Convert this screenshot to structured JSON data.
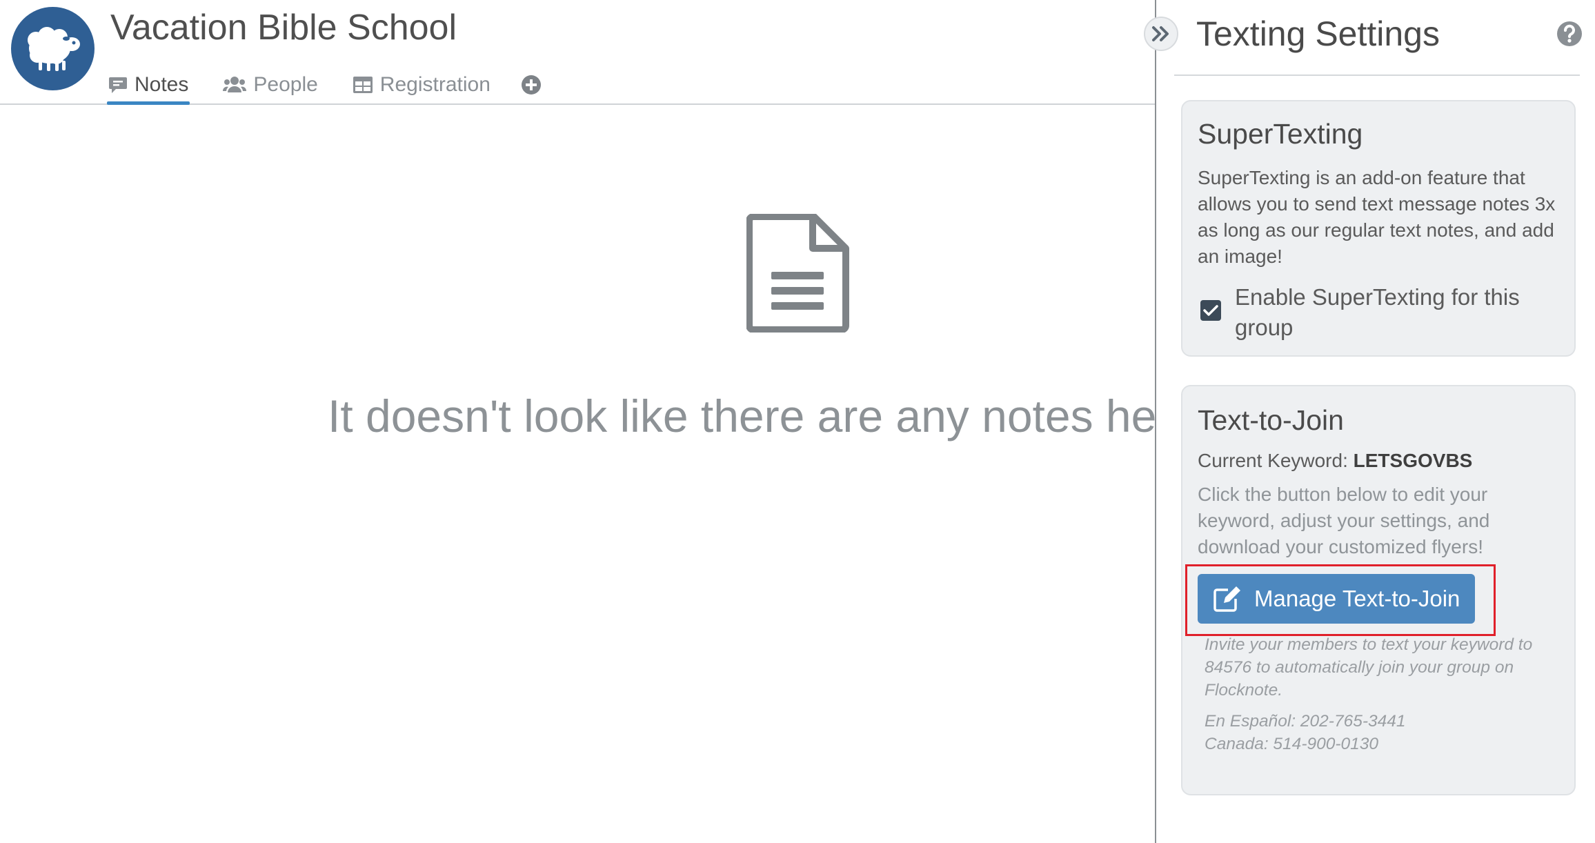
{
  "group": {
    "title": "Vacation Bible School",
    "logo_icon": "sheep-icon"
  },
  "tabs": [
    {
      "label": "Notes",
      "icon": "note-icon",
      "active": true
    },
    {
      "label": "People",
      "icon": "people-icon",
      "active": false
    },
    {
      "label": "Registration",
      "icon": "table-icon",
      "active": false
    }
  ],
  "empty_state": {
    "icon": "document-icon",
    "message": "It doesn't look like there are any notes here yet."
  },
  "panel": {
    "title": "Texting Settings",
    "supertexting": {
      "heading": "SuperTexting",
      "description": "SuperTexting is an add-on feature that allows you to send text message notes 3x as long as our regular text notes, and add an image!",
      "checkbox_label": "Enable SuperTexting for this group",
      "checked": true
    },
    "text_to_join": {
      "heading": "Text-to-Join",
      "keyword_label": "Current Keyword:",
      "keyword": "LETSGOVBS",
      "instructions": "Click the button below to edit your keyword, adjust your settings, and download your customized flyers!",
      "button_label": "Manage Text-to-Join",
      "invite": "Invite your members to text your keyword to 84576 to automatically join your group on Flocknote.",
      "espanol": "En Español: 202-765-3441",
      "canada": "Canada: 514-900-0130"
    }
  },
  "colors": {
    "brand_blue": "#2f5f94",
    "button_blue": "#4d88bf",
    "tab_underline": "#3a86c3",
    "highlight_red": "#e0202a"
  }
}
